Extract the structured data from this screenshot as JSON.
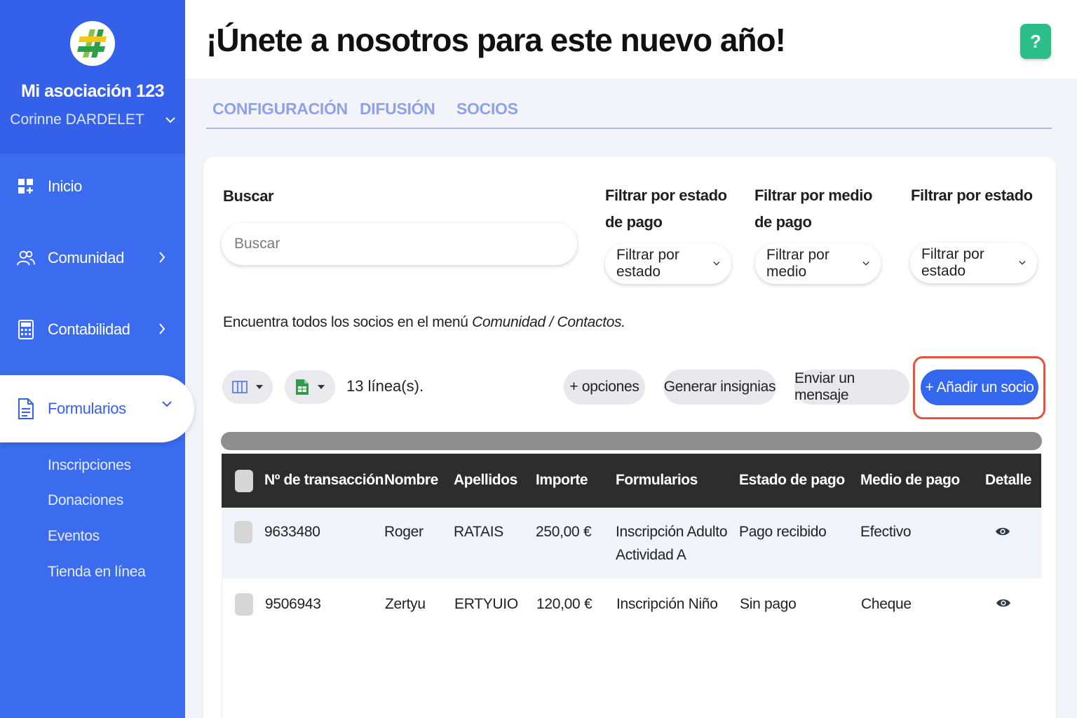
{
  "sidebar": {
    "org_name": "Mi asociación 123",
    "user_name": "Corinne DARDELET",
    "items": [
      {
        "label": "Inicio",
        "icon": "dashboard-icon"
      },
      {
        "label": "Comunidad",
        "icon": "users-icon"
      },
      {
        "label": "Contabilidad",
        "icon": "calculator-icon"
      },
      {
        "label": "Formularios",
        "icon": "document-icon"
      }
    ],
    "sub_items": [
      "Inscripciones",
      "Donaciones",
      "Eventos",
      "Tienda en línea"
    ]
  },
  "header": {
    "title": "¡Únete a nosotros para este nuevo año!",
    "help_label": "?"
  },
  "tabs": [
    "CONFIGURACIÓN",
    "DIFUSIÓN",
    "SOCIOS"
  ],
  "filters": {
    "search_label": "Buscar",
    "search_placeholder": "Buscar",
    "payment_status_label_1": "Filtrar por estado",
    "payment_status_label_2": "de pago",
    "payment_status_value": "Filtrar por estado",
    "payment_method_label_1": "Filtrar por medio",
    "payment_method_label_2": "de pago",
    "payment_method_value": "Filtrar por medio",
    "status_label": "Filtrar por estado",
    "status_value": "Filtrar por estado"
  },
  "info": {
    "prefix": "Encuentra todos los socios en el menú ",
    "path": "Comunidad / Contactos."
  },
  "toolbar": {
    "rows_count": "13 línea(s).",
    "options_label": "+ opciones",
    "badges_label": "Generar insignias",
    "message_label": "Enviar un mensaje",
    "add_label": "+ Añadir un socio",
    "highlight_color": "#e8523b",
    "accent_color": "#3367ee"
  },
  "table": {
    "headers": [
      "Nº de transacción",
      "Nombre",
      "Apellidos",
      "Importe",
      "Formularios",
      "Estado de pago",
      "Medio de pago",
      "Detalle"
    ],
    "rows": [
      {
        "id": "9633480",
        "name": "Roger",
        "surname": "RATAIS",
        "amount": "250,00 €",
        "form_1": "Inscripción Adulto",
        "form_2": "Actividad A",
        "status": "Pago recibido",
        "method": "Efectivo"
      },
      {
        "id": "9506943",
        "name": "Zertyu",
        "surname": "ERTYUIO",
        "amount": "120,00 €",
        "form_1": "Inscripción Niño",
        "form_2": "",
        "status": "Sin pago",
        "method": "Cheque"
      }
    ]
  }
}
